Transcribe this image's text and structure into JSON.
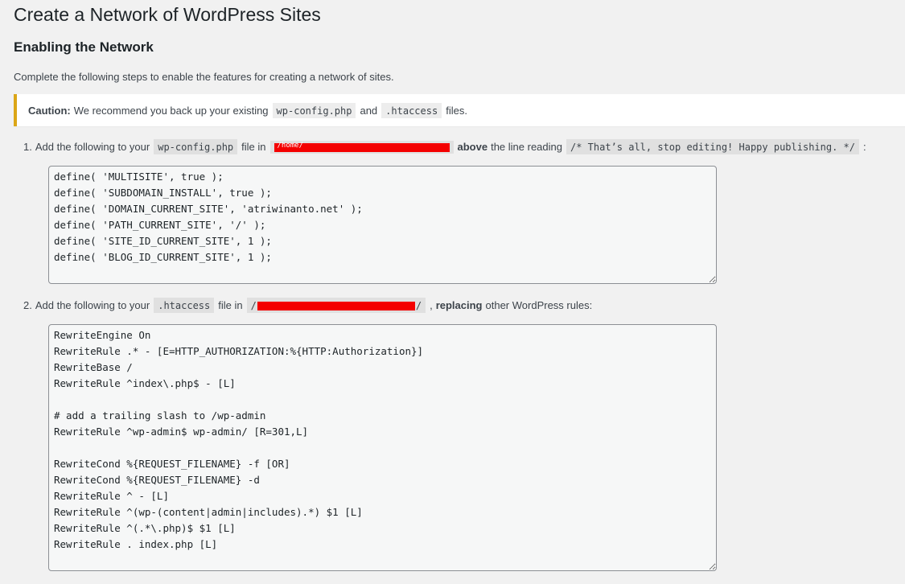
{
  "page_title": "Create a Network of WordPress Sites",
  "section_title": "Enabling the Network",
  "intro_text": "Complete the following steps to enable the features for creating a network of sites.",
  "notice": {
    "label": "Caution:",
    "text_before": "We recommend you back up your existing",
    "code1": "wp-config.php",
    "text_mid": "and",
    "code2": ".htaccess",
    "text_after": "files.",
    "border_color": "#dba617"
  },
  "step1": {
    "number": "1.",
    "text_before": "Add the following to your",
    "file_code": "wp-config.php",
    "text_file_in": "file in",
    "path_prefix": "/home/",
    "path_suffix": "",
    "bold_text": "above",
    "text_after": "the line reading",
    "stop_line": "/* That’s all, stop editing! Happy publishing. */",
    "trailing": ":",
    "code": "define( 'MULTISITE', true );\ndefine( 'SUBDOMAIN_INSTALL', true );\ndefine( 'DOMAIN_CURRENT_SITE', 'atriwinanto.net' );\ndefine( 'PATH_CURRENT_SITE', '/' );\ndefine( 'SITE_ID_CURRENT_SITE', 1 );\ndefine( 'BLOG_ID_CURRENT_SITE', 1 );"
  },
  "step2": {
    "number": "2.",
    "text_before": "Add the following to your",
    "file_code": ".htaccess",
    "text_file_in": "file in",
    "path_prefix": "/",
    "path_suffix": "/",
    "text_after": ",",
    "bold_text": "replacing",
    "text_end": "other WordPress rules:",
    "code": "RewriteEngine On\nRewriteRule .* - [E=HTTP_AUTHORIZATION:%{HTTP:Authorization}]\nRewriteBase /\nRewriteRule ^index\\.php$ - [L]\n\n# add a trailing slash to /wp-admin\nRewriteRule ^wp-admin$ wp-admin/ [R=301,L]\n\nRewriteCond %{REQUEST_FILENAME} -f [OR]\nRewriteCond %{REQUEST_FILENAME} -d\nRewriteRule ^ - [L]\nRewriteRule ^(wp-(content|admin|includes).*) $1 [L]\nRewriteRule ^(.*\\.php)$ $1 [L]\nRewriteRule . index.php [L]"
  },
  "colors": {
    "page_bg": "#f1f1f1",
    "redaction": "#f40000"
  }
}
